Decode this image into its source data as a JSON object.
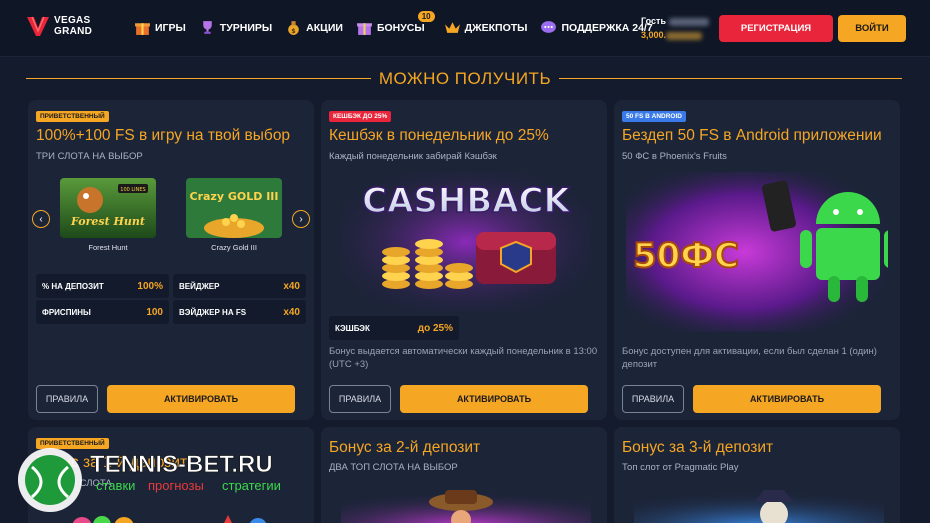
{
  "brand": {
    "line1": "VEGAS",
    "line2": "GRAND"
  },
  "nav": [
    {
      "label": "ИГРЫ",
      "icon": "gift-icon"
    },
    {
      "label": "ТУРНИРЫ",
      "icon": "trophy-icon"
    },
    {
      "label": "АКЦИИ",
      "icon": "money-bag-icon"
    },
    {
      "label": "БОНУСЫ",
      "icon": "present-icon",
      "badge": "10"
    },
    {
      "label": "ДЖЕКПОТЫ",
      "icon": "crown-icon"
    },
    {
      "label": "ПОДДЕРЖКА 24/7",
      "icon": "chat-icon"
    }
  ],
  "guest": {
    "label": "Гость",
    "balance": "3,000."
  },
  "buttons": {
    "register": "РЕГИСТРАЦИЯ",
    "login": "ВОЙТИ"
  },
  "section_title": "МОЖНО ПОЛУЧИТЬ",
  "cards": [
    {
      "tag": "ПРИВЕТСТВЕННЫЙ",
      "title": "100%+100 FS в игру на твой выбор",
      "subtitle": "ТРИ СЛОТА НА ВЫБОР",
      "slots": [
        {
          "name": "Forest Hunt",
          "art": "Forest Hunt",
          "art_badge": "100 LINES"
        },
        {
          "name": "Crazy Gold III",
          "art": "Crazy GOLD III"
        }
      ],
      "stats": [
        {
          "label": "% НА ДЕПОЗИТ",
          "value": "100%"
        },
        {
          "label": "ВЕЙДЖЕР",
          "value": "x40"
        },
        {
          "label": "ФРИСПИНЫ",
          "value": "100"
        },
        {
          "label": "ВЭЙДЖЕР НА FS",
          "value": "x40"
        }
      ],
      "rules": "ПРАВИЛА",
      "activate": "АКТИВИРОВАТЬ"
    },
    {
      "tag": "КЕШБЭК ДО 25%",
      "title": "Кешбэк в понедельник до 25%",
      "subtitle": "Каждый понедельник забирай Кэшбэк",
      "image_text": "CASHBACK",
      "stat": {
        "label": "КЭШБЭК",
        "value": "до 25%"
      },
      "description": "Бонус выдается автоматически каждый понедельник в 13:00 (UTC +3)",
      "rules": "ПРАВИЛА",
      "activate": "АКТИВИРОВАТЬ"
    },
    {
      "tag": "50 FS В ANDROID",
      "title": "Бездеп 50 FS в Android приложении",
      "subtitle": "50 ФС в Phoenix's Fruits",
      "image_text": "50ФС",
      "description": "Бонус доступен для активации, если был сделан 1 (один) депозит",
      "rules": "ПРАВИЛА",
      "activate": "АКТИВИРОВАТЬ"
    },
    {
      "tag": "ПРИВЕТСТВЕННЫЙ",
      "title": "Бонус за 1-й депозит",
      "subtitle": "ДВА ТОП СЛОТА"
    },
    {
      "tag": "",
      "title": "Бонус за 2-й депозит",
      "subtitle": "ДВА ТОП СЛОТА НА ВЫБОР"
    },
    {
      "tag": "",
      "title": "Бонус за 3-й депозит",
      "subtitle": "Топ слот от Pragmatic Play"
    }
  ],
  "watermark": {
    "site": "TENNIS-BET.RU",
    "w1": "ставки",
    "w2": "прогнозы",
    "w3": "стратегии"
  },
  "colors": {
    "accent": "#f5a623",
    "register": "#e8253a",
    "bg": "#131b2c",
    "card": "#1c2438"
  }
}
